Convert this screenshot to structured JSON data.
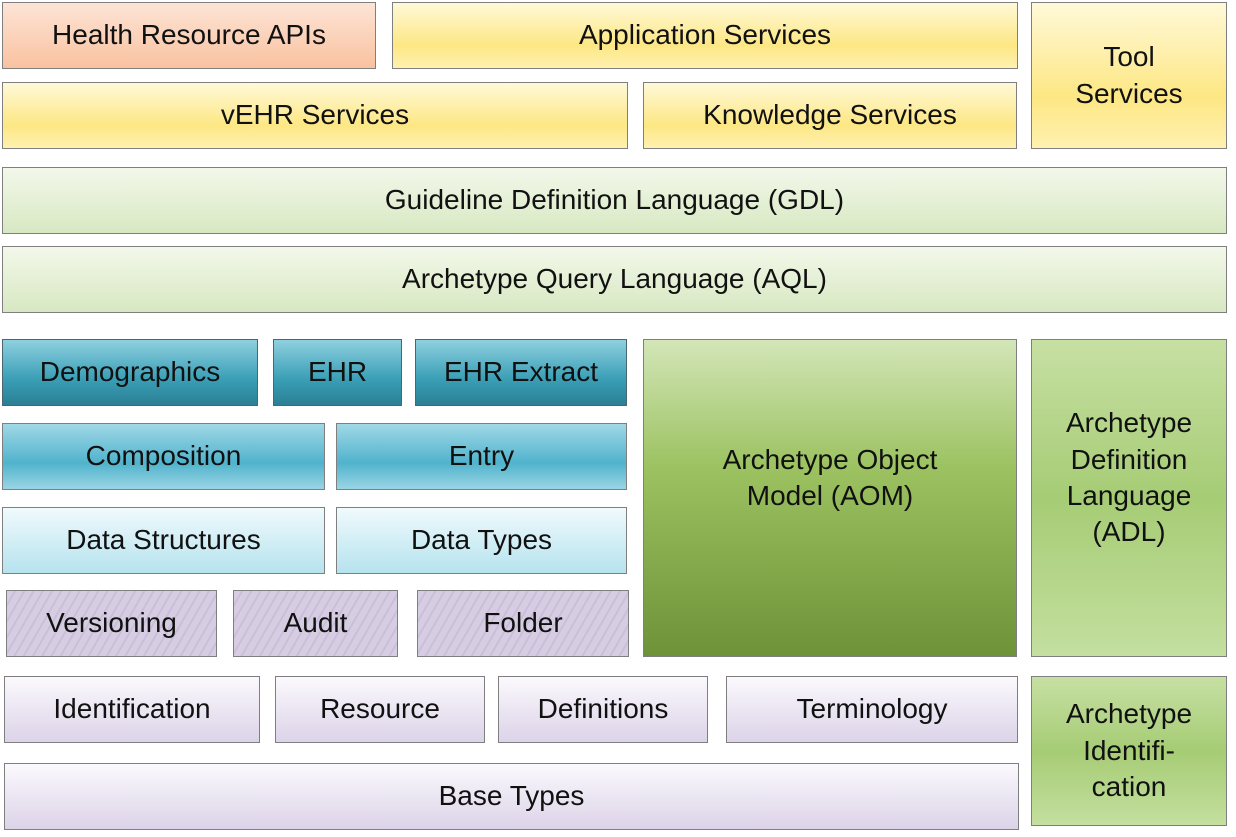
{
  "boxes": {
    "health_resource_apis": "Health Resource APIs",
    "application_services": "Application Services",
    "tool_services": "Tool\nServices",
    "vehr_services": "vEHR Services",
    "knowledge_services": "Knowledge Services",
    "gdl": "Guideline Definition Language (GDL)",
    "aql": "Archetype Query Language (AQL)",
    "demographics": "Demographics",
    "ehr": "EHR",
    "ehr_extract": "EHR Extract",
    "composition": "Composition",
    "entry": "Entry",
    "data_structures": "Data Structures",
    "data_types": "Data Types",
    "versioning": "Versioning",
    "audit": "Audit",
    "folder": "Folder",
    "aom": "Archetype Object\nModel (AOM)",
    "adl": "Archetype\nDefinition\nLanguage\n(ADL)",
    "identification": "Identification",
    "resource": "Resource",
    "definitions": "Definitions",
    "terminology": "Terminology",
    "base_types": "Base Types",
    "archetype_identification": "Archetype\nIdentifi-\ncation"
  },
  "colors": {
    "services": "#fde784",
    "apis": "#f9c2a0",
    "languages": "#d7e8c2",
    "rm_core": "#3a9fb6",
    "rm_data": "#b6e3ee",
    "rm_common": "#cabfda",
    "base": "#dcd3e8",
    "am": "#9cc261"
  }
}
